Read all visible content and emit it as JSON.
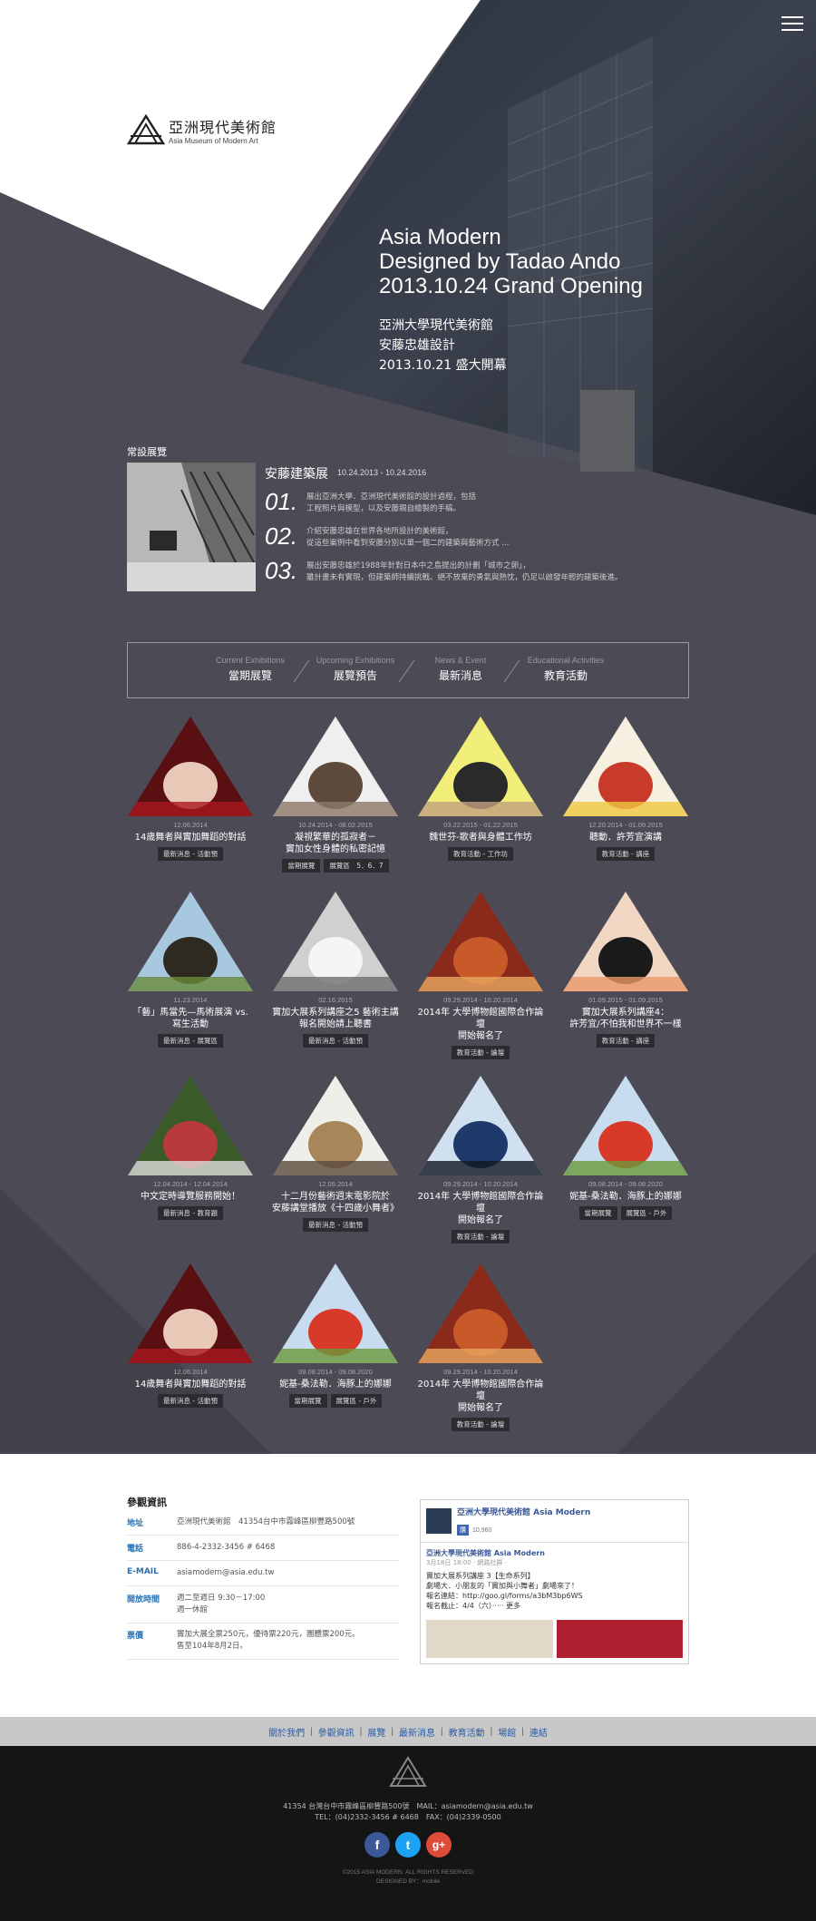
{
  "menu": {
    "icon": "hamburger-menu-icon"
  },
  "logo": {
    "cn": "亞洲現代美術館",
    "en": "Asia Museum of Modern Art"
  },
  "hero": {
    "line1": "Asia Modern",
    "line2": "Designed by Tadao Ando",
    "line3": "2013.10.24 Grand Opening",
    "cn1": "亞洲大學現代美術館",
    "cn2": "安藤忠雄設計",
    "cn3": "2013.10.21 盛大開幕"
  },
  "permanent": {
    "label": "常設展覽",
    "title": "安藤建築展",
    "date": "10.24.2013 - 10.24.2016",
    "items": [
      {
        "num": "01.",
        "text": "展出亞洲大學．亞洲現代美術館的設計過程，包括\n工程照片與模型，以及安藤親自繪製的手稿。"
      },
      {
        "num": "02.",
        "text": "介紹安藤忠雄在世界各地所設計的美術館，\n從這些案例中看到安藤分別以單一個二的建築與藝術方式 ..."
      },
      {
        "num": "03.",
        "text": "展出安藤忠雄於1988年針對日本中之島提出的計劃「城市之卵」，\n雖計畫未有實現，但建築師持續挑戰、絕不放棄的勇氣與熱忱，仍足以啟發年輕的建築後進。"
      }
    ]
  },
  "tabs": [
    {
      "en": "Current Exhibitions",
      "cn": "當期展覽"
    },
    {
      "en": "Upcoming Exhibitions",
      "cn": "展覽預告"
    },
    {
      "en": "News & Event",
      "cn": "最新消息"
    },
    {
      "en": "Educational Activities",
      "cn": "教育活動"
    }
  ],
  "cards": [
    {
      "date": "12.06.2014",
      "title": "14歲舞者與竇加舞蹈的對話",
      "tags": [
        "最新消息 - 活動預"
      ],
      "colors": [
        "#5a1012",
        "#e8c9b8",
        "#a8181e"
      ]
    },
    {
      "date": "10.24.2014 - 08.02.2015",
      "title": "凝視繁華的孤寂者－\n竇加女性身體的私密記憶",
      "tags": [
        "當期展覽",
        "展覽區　5．6．7"
      ],
      "colors": [
        "#efefef",
        "#5e4a3c",
        "#8b7868"
      ]
    },
    {
      "date": "03.22.2015 - 01.22.2015",
      "title": "魏世芬-歌者與身體工作坊",
      "tags": [
        "教育活動 - 工作坊"
      ],
      "colors": [
        "#f2ee7a",
        "#2a2a2a",
        "#c0a080"
      ]
    },
    {
      "date": "12.20.2014 - 01.09.2015",
      "title": "聽動．許芳宜演講",
      "tags": [
        "教育活動 - 講座"
      ],
      "colors": [
        "#f5f0e0",
        "#c83a2a",
        "#f0c840"
      ]
    },
    {
      "date": "11.23.2014",
      "title": "「藝」馬當先—馬術展演 vs.\n寫生活動",
      "tags": [
        "最新消息 - 展覽區"
      ],
      "colors": [
        "#a8c8e0",
        "#2e2a22",
        "#6a8a3a"
      ]
    },
    {
      "date": "02.16.2015",
      "title": "竇加大展系列講座之5 藝術主講\n報名開始請上聽書",
      "tags": [
        "最新消息 - 活動預"
      ],
      "colors": [
        "#d0d0d0",
        "#f5f5f5",
        "#6e6e6e"
      ]
    },
    {
      "date": "09.29.2014 - 10.20.2014",
      "title": "2014年 大學博物館國際合作論壇\n開始報名了",
      "tags": [
        "教育活動 - 論壇"
      ],
      "colors": [
        "#8a2a1a",
        "#c85a2a",
        "#e8a860"
      ]
    },
    {
      "date": "01.09.2015 - 01.09.2015",
      "title": "竇加大展系列講座4：\n許芳宜/不怕我和世界不一樣",
      "tags": [
        "教育活動 - 講座"
      ],
      "colors": [
        "#f2d6c4",
        "#1a1a1a",
        "#e89868"
      ]
    },
    {
      "date": "12.04.2014 - 12.04.2014",
      "title": "中文定時導覽服務開始！",
      "tags": [
        "最新消息 - 教育題"
      ],
      "colors": [
        "#3a5a2a",
        "#b83a3a",
        "#dcdcdc"
      ]
    },
    {
      "date": "12.05.2014",
      "title": "十二月份藝術週末電影院於\n安藤講堂播放《十四歲小舞者》",
      "tags": [
        "最新消息 - 活動預"
      ],
      "colors": [
        "#efefea",
        "#a8865a",
        "#5a4a3a"
      ]
    },
    {
      "date": "09.29.2014 - 10.20.2014",
      "title": "2014年 大學博物館國際合作論壇\n開始報名了",
      "tags": [
        "教育活動 - 論壇"
      ],
      "colors": [
        "#d0e0f0",
        "#1e3a6a",
        "#101820"
      ]
    },
    {
      "date": "09.08.2014 - 09.08.2020",
      "title": "妮基-桑法勒．海豚上的娜娜",
      "tags": [
        "當期展覽",
        "展覽區 - 戶外"
      ],
      "colors": [
        "#c8dcf0",
        "#d83a2a",
        "#6a9a3a"
      ]
    },
    {
      "date": "12.06.2014",
      "title": "14歲舞者與竇加舞蹈的對話",
      "tags": [
        "最新消息 - 活動預"
      ],
      "colors": [
        "#5a1012",
        "#e8c9b8",
        "#a8181e"
      ]
    },
    {
      "date": "09.08.2014 - 09.08.2020",
      "title": "妮基-桑法勒．海豚上的娜娜",
      "tags": [
        "當期展覽",
        "展覽區 - 戶外"
      ],
      "colors": [
        "#c8dcf0",
        "#d83a2a",
        "#6a9a3a"
      ]
    },
    {
      "date": "09.29.2014 - 10.20.2014",
      "title": "2014年 大學博物館國際合作論壇\n開始報名了",
      "tags": [
        "教育活動 - 論壇"
      ],
      "colors": [
        "#8a2a1a",
        "#c85a2a",
        "#e8a860"
      ]
    }
  ],
  "info": {
    "label": "參觀資訊",
    "rows": [
      {
        "k": "地址",
        "v": "亞洲現代美術館　41354台中市霧峰區柳豐路500號"
      },
      {
        "k": "電話",
        "v": "886-4-2332-3456 # 6468"
      },
      {
        "k": "E-MAIL",
        "v": "asiamodern@asia.edu.tw"
      },
      {
        "k": "開放時間",
        "v": "週二至週日 9:30－17:00\n週一休館"
      },
      {
        "k": "票價",
        "v": "竇加大展全票250元，優待票220元，團體票200元。\n售至104年8月2日。"
      }
    ]
  },
  "fb": {
    "page": "亞洲大學現代美術館 Asia Modern",
    "like": "讚",
    "count": "10,960",
    "post_name": "亞洲大學現代美術館 Asia Modern",
    "post_time": "3月18日 18:00 · 網路社群 ·",
    "post_text": "竇加大展系列講座 3【生命系列】\n劇場大．小朋友的「竇加與小舞者」劇場來了！\n報名連結：http://goo.gl/forms/a3bM3bp6WS\n報名截止：4/4（六）····· 更多"
  },
  "nav": [
    "關於我們",
    "參觀資訊",
    "展覽",
    "最新消息",
    "教育活動",
    "場館",
    "連結"
  ],
  "footer": {
    "addr": "41354 台灣台中市霧峰區柳豐路500號　MAIL：asiamodern@asia.edu.tw",
    "tel": "TEL：(04)2332-3456 # 6468　FAX：(04)2339-0500",
    "copy": "©2015 ASIA MODERN. ALL RIGHTS RESERVED",
    "design": "DESIGNED BY：mobile"
  },
  "social": [
    "f",
    "t",
    "g+"
  ]
}
